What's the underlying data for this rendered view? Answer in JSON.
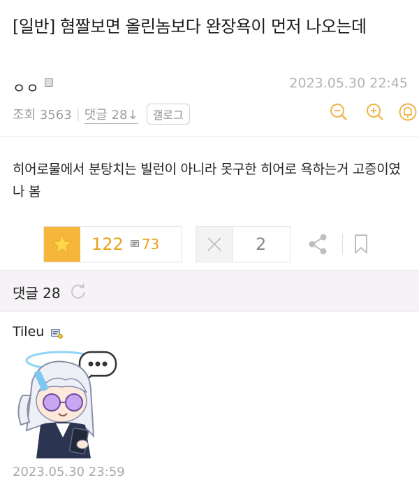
{
  "post": {
    "title": "[일반] 혐짤보면 올린놈보다 완장욕이 먼저 나오는데",
    "author": "ㅇㅇ",
    "datetime": "2023.05.30 22:45",
    "views_label": "조회 3563",
    "comments_label": "댓글 28↓",
    "gallery_button": "갤로그",
    "body": "히어로물에서 분탕치는 빌런이 아니라 못구한 히어로 욕하는거 고증이였나 봄"
  },
  "votes": {
    "up_count": "122",
    "comment_mini_count": "73",
    "down_count": "2"
  },
  "comments": {
    "header": "댓글 28",
    "items": [
      {
        "author": "Tileu",
        "date": "2023.05.30 23:59"
      }
    ]
  },
  "colors": {
    "accent": "#f6b63c",
    "accent_text": "#e8a21a",
    "meta_gray": "#9e9e9e"
  }
}
